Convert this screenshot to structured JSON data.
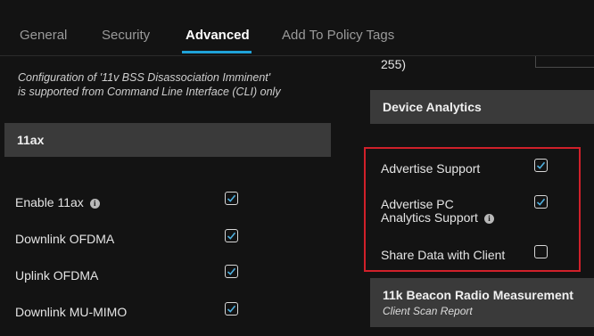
{
  "tabs": [
    {
      "label": "General"
    },
    {
      "label": "Security"
    },
    {
      "label": "Advanced"
    },
    {
      "label": "Add To Policy Tags"
    }
  ],
  "note": {
    "line1": "Configuration of '11v BSS Disassociation Imminent'",
    "line2": "is supported from Command Line Interface (CLI) only"
  },
  "ax_section": {
    "title": "11ax",
    "rows": [
      {
        "label": "Enable 11ax",
        "checked": true,
        "info": true
      },
      {
        "label": "Downlink OFDMA",
        "checked": true
      },
      {
        "label": "Uplink OFDMA",
        "checked": true
      },
      {
        "label": "Downlink MU-MIMO",
        "checked": true
      }
    ]
  },
  "right_partial_text": "255)",
  "device_analytics": {
    "title": "Device Analytics",
    "rows": [
      {
        "label": "Advertise Support",
        "checked": true
      },
      {
        "label_line1": "Advertise PC",
        "label_line2": "Analytics Support",
        "checked": true,
        "info": true
      },
      {
        "label": "Share Data with Client",
        "checked": false
      }
    ]
  },
  "beacon": {
    "title": "11k Beacon Radio Measurement",
    "subtitle": "Client Scan Report"
  },
  "info_icon_glyph": "i",
  "colors": {
    "accent": "#1fa2d8",
    "highlight": "#d0202a",
    "check": "#4fb0e0"
  }
}
